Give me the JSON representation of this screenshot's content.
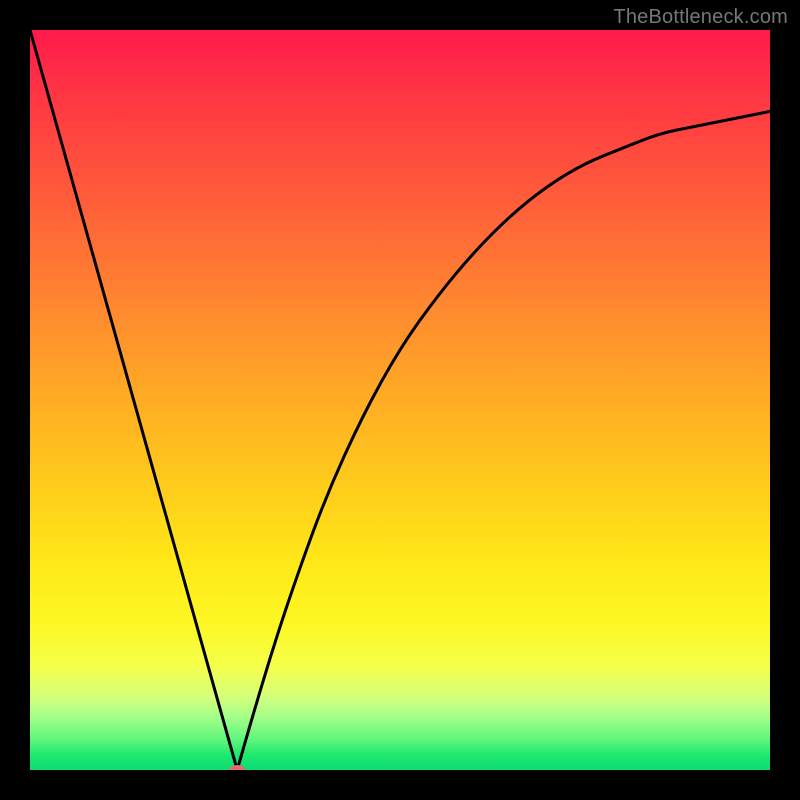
{
  "watermark": "TheBottleneck.com",
  "chart_data": {
    "type": "line",
    "title": "",
    "xlabel": "",
    "ylabel": "",
    "xlim": [
      0,
      1
    ],
    "ylim": [
      0,
      1
    ],
    "notch_x": 0.28,
    "marker": {
      "x": 0.28,
      "y": 0.0,
      "color": "#e46a6f"
    },
    "series": [
      {
        "name": "curve",
        "x": [
          0.0,
          0.05,
          0.1,
          0.15,
          0.2,
          0.25,
          0.28,
          0.3,
          0.33,
          0.36,
          0.4,
          0.45,
          0.5,
          0.55,
          0.6,
          0.65,
          0.7,
          0.75,
          0.8,
          0.85,
          0.9,
          0.95,
          1.0
        ],
        "values": [
          1.0,
          0.82,
          0.64,
          0.46,
          0.28,
          0.1,
          0.0,
          0.07,
          0.17,
          0.26,
          0.37,
          0.48,
          0.57,
          0.64,
          0.7,
          0.75,
          0.79,
          0.82,
          0.84,
          0.86,
          0.87,
          0.88,
          0.89
        ]
      }
    ]
  }
}
